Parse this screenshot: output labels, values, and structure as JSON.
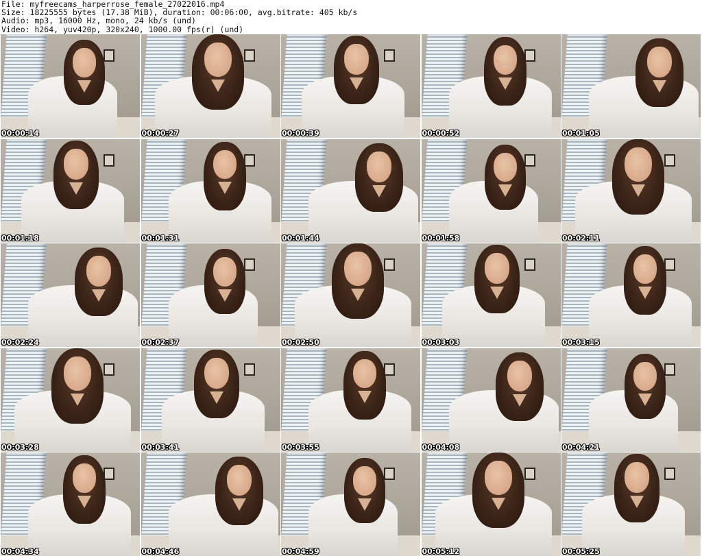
{
  "header": {
    "file_line": "File: myfreecams_harperrose_female_27022016.mp4",
    "size_line": "Size: 18225555 bytes (17.38 MiB), duration: 00:06:00, avg.bitrate: 405 kb/s",
    "audio_line": "Audio: mp3, 16000 Hz, mono, 24 kb/s (und)",
    "video_line": "Video: h264, yuv420p, 320x240, 1000.00 fps(r) (und)"
  },
  "thumbnails": [
    {
      "timestamp": "00:00:14"
    },
    {
      "timestamp": "00:00:27"
    },
    {
      "timestamp": "00:00:39"
    },
    {
      "timestamp": "00:00:52"
    },
    {
      "timestamp": "00:01:05"
    },
    {
      "timestamp": "00:01:18"
    },
    {
      "timestamp": "00:01:31"
    },
    {
      "timestamp": "00:01:44"
    },
    {
      "timestamp": "00:01:58"
    },
    {
      "timestamp": "00:02:11"
    },
    {
      "timestamp": "00:02:24"
    },
    {
      "timestamp": "00:02:37"
    },
    {
      "timestamp": "00:02:50"
    },
    {
      "timestamp": "00:03:03"
    },
    {
      "timestamp": "00:03:15"
    },
    {
      "timestamp": "00:03:28"
    },
    {
      "timestamp": "00:03:41"
    },
    {
      "timestamp": "00:03:55"
    },
    {
      "timestamp": "00:04:08"
    },
    {
      "timestamp": "00:04:21"
    },
    {
      "timestamp": "00:04:34"
    },
    {
      "timestamp": "00:04:46"
    },
    {
      "timestamp": "00:04:59"
    },
    {
      "timestamp": "00:05:12"
    },
    {
      "timestamp": "00:05:25"
    }
  ]
}
